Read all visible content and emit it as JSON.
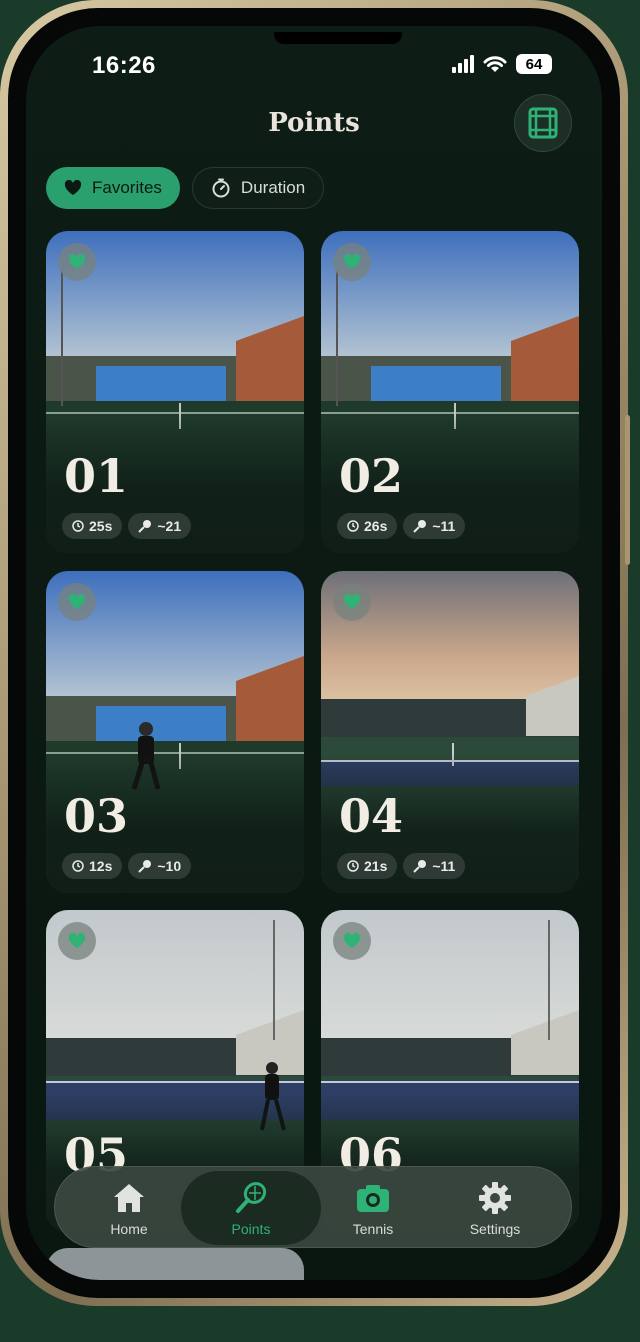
{
  "status_bar": {
    "time": "16:26",
    "battery": "64"
  },
  "header": {
    "title": "Points"
  },
  "filters": [
    {
      "label": "Favorites",
      "active": true,
      "icon": "heart-icon"
    },
    {
      "label": "Duration",
      "active": false,
      "icon": "timer-icon"
    }
  ],
  "cards": [
    {
      "number": "01",
      "duration": "25s",
      "shots": "~21",
      "favorite": true
    },
    {
      "number": "02",
      "duration": "26s",
      "shots": "~11",
      "favorite": true
    },
    {
      "number": "03",
      "duration": "12s",
      "shots": "~10",
      "favorite": true
    },
    {
      "number": "04",
      "duration": "21s",
      "shots": "~11",
      "favorite": true
    },
    {
      "number": "05",
      "favorite": true
    },
    {
      "number": "06",
      "favorite": true
    }
  ],
  "tabbar": {
    "items": [
      {
        "label": "Home",
        "icon": "house-icon"
      },
      {
        "label": "Points",
        "icon": "racket-icon",
        "active": true
      },
      {
        "label": "Tennis",
        "icon": "camera-icon"
      },
      {
        "label": "Settings",
        "icon": "gear-icon"
      }
    ]
  },
  "colors": {
    "accent": "#2aa06e",
    "background": "#0d1c15"
  }
}
